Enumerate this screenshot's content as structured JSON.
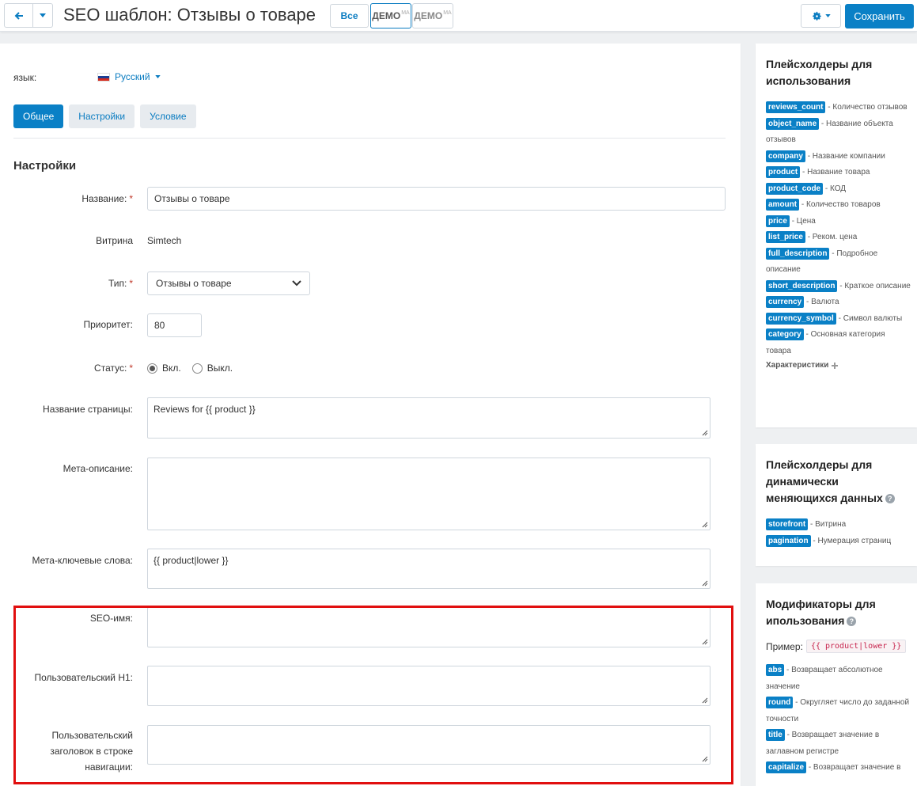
{
  "header": {
    "title": "SEO шаблон: Отзывы о товаре",
    "filter_all": "Все",
    "demo_label": "ДЕМО",
    "demo_sup": "MA",
    "save_label": "Сохранить"
  },
  "language": {
    "label": "язык:",
    "selected": "Русский"
  },
  "tabs": [
    {
      "label": "Общее"
    },
    {
      "label": "Настройки"
    },
    {
      "label": "Условие"
    }
  ],
  "form": {
    "section_title": "Настройки",
    "name": {
      "label": "Название:",
      "value": "Отзывы о товаре"
    },
    "storefront": {
      "label": "Витрина",
      "value": "Simtech"
    },
    "type": {
      "label": "Тип:",
      "value": "Отзывы о товаре"
    },
    "priority": {
      "label": "Приоритет:",
      "value": "80"
    },
    "status": {
      "label": "Статус:",
      "on": "Вкл.",
      "off": "Выкл."
    },
    "page_title": {
      "label": "Название страницы:",
      "value": "Reviews for {{ product }}"
    },
    "meta_description": {
      "label": "Мета-описание:",
      "value": ""
    },
    "meta_keywords": {
      "label": "Мета-ключевые слова:",
      "value": "{{ product|lower }}"
    },
    "seo_name": {
      "label": "SEO-имя:",
      "value": ""
    },
    "custom_h1": {
      "label": "Пользовательский H1:",
      "value": ""
    },
    "breadcrumb_title": {
      "label_1": "Пользовательский",
      "label_2": "заголовок в строке",
      "label_3": "навигации:",
      "value": ""
    }
  },
  "sidebar": {
    "placeholders": {
      "title_1": "Плейсхолдеры для",
      "title_2": "использования",
      "items": [
        {
          "tag": "reviews_count",
          "desc": "- Количество отзывов"
        },
        {
          "tag": "object_name",
          "desc": "- Название объекта отзывов"
        },
        {
          "tag": "company",
          "desc": "- Название компании"
        },
        {
          "tag": "product",
          "desc": "- Название товара"
        },
        {
          "tag": "product_code",
          "desc": "- КОД"
        },
        {
          "tag": "amount",
          "desc": "- Количество товаров"
        },
        {
          "tag": "price",
          "desc": "- Цена"
        },
        {
          "tag": "list_price",
          "desc": "- Реком. цена"
        },
        {
          "tag": "full_description",
          "desc": "- Подробное описание"
        },
        {
          "tag": "short_description",
          "desc": "- Краткое описание"
        },
        {
          "tag": "currency",
          "desc": "- Валюта"
        },
        {
          "tag": "currency_symbol",
          "desc": "- Символ валюты"
        },
        {
          "tag": "category",
          "desc": "- Основная категория товара"
        }
      ],
      "more": "Характеристики"
    },
    "dynamic": {
      "title_1": "Плейсхолдеры для",
      "title_2": "динамически",
      "title_3": "меняющихся данных",
      "items": [
        {
          "tag": "storefront",
          "desc": "- Витрина"
        },
        {
          "tag": "pagination",
          "desc": "- Нумерация страниц"
        }
      ]
    },
    "modifiers": {
      "title_1": "Модификаторы для",
      "title_2": "ипользования",
      "example_label": "Пример:",
      "example_code": "{{ product|lower }}",
      "items": [
        {
          "tag": "abs",
          "desc": "- Возвращает абсолютное значение"
        },
        {
          "tag": "round",
          "desc": "- Округляет число до заданной точности"
        },
        {
          "tag": "title",
          "desc": "- Возвращает значение в заглавном регистре"
        },
        {
          "tag": "capitalize",
          "desc": "- Возвращает значение в"
        }
      ]
    }
  }
}
